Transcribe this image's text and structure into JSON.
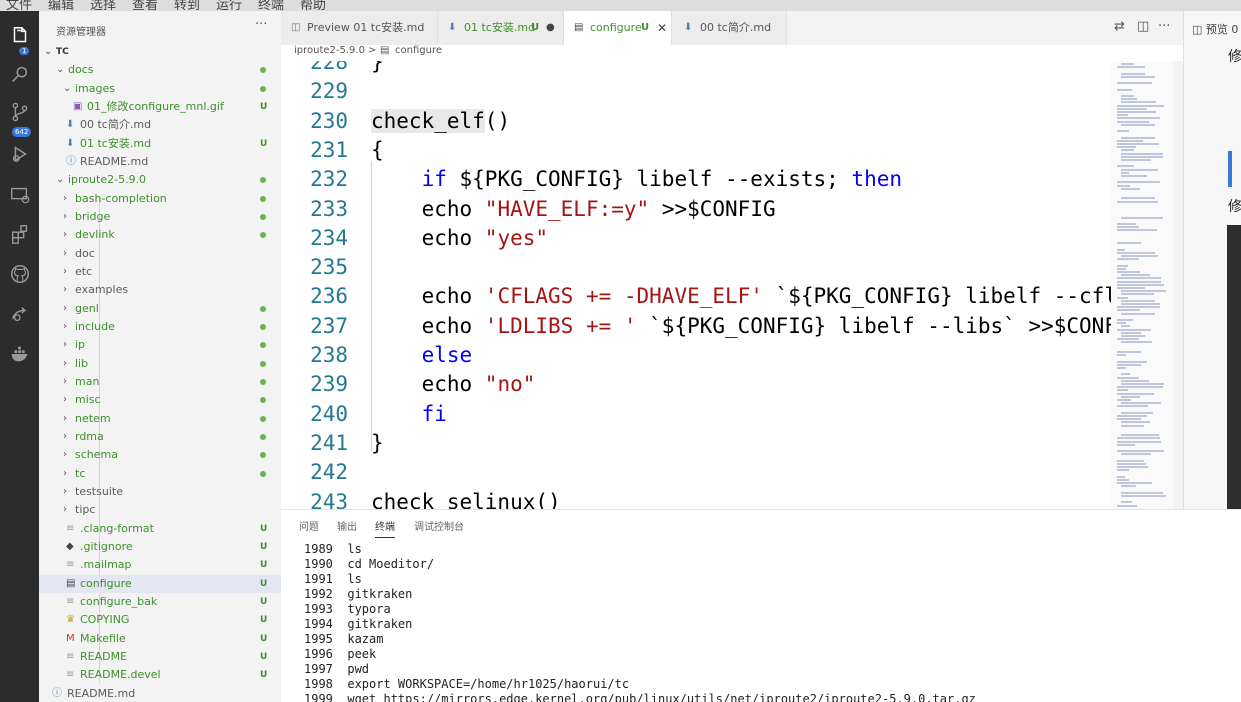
{
  "menu": [
    "文件",
    "编辑",
    "选择",
    "查看",
    "转到",
    "运行",
    "终端",
    "帮助"
  ],
  "activity": {
    "explorer_badge": "1",
    "scm_badge": "642"
  },
  "sidebar": {
    "title": "资源管理器",
    "more": "···",
    "root": "TC",
    "items": [
      {
        "label": "docs",
        "type": "folder-open",
        "status": "dot"
      },
      {
        "label": "images",
        "type": "folder-open",
        "status": "dot"
      },
      {
        "label": "01_修改configure_mnl.gif",
        "type": "image",
        "status": "U"
      },
      {
        "label": "00 tc简介.md",
        "type": "md",
        "status": ""
      },
      {
        "label": "01 tc安装.md",
        "type": "md",
        "status": "U"
      },
      {
        "label": "README.md",
        "type": "info",
        "status": ""
      },
      {
        "label": "iproute2-5.9.0",
        "type": "folder-open",
        "status": "dot"
      },
      {
        "label": "bash-completion",
        "type": "folder",
        "status": "dot"
      },
      {
        "label": "bridge",
        "type": "folder",
        "status": "dot"
      },
      {
        "label": "devlink",
        "type": "folder",
        "status": "dot"
      },
      {
        "label": "doc",
        "type": "folder",
        "status": ""
      },
      {
        "label": "etc",
        "type": "folder",
        "status": ""
      },
      {
        "label": "examples",
        "type": "folder",
        "status": ""
      },
      {
        "label": "genl",
        "type": "folder",
        "status": "dot"
      },
      {
        "label": "include",
        "type": "folder",
        "status": "dot"
      },
      {
        "label": "ip",
        "type": "folder",
        "status": "dot"
      },
      {
        "label": "lib",
        "type": "folder",
        "status": "dot"
      },
      {
        "label": "man",
        "type": "folder",
        "status": "dot"
      },
      {
        "label": "misc",
        "type": "folder",
        "status": "dot"
      },
      {
        "label": "netem",
        "type": "folder",
        "status": "dot"
      },
      {
        "label": "rdma",
        "type": "folder",
        "status": "dot"
      },
      {
        "label": "schema",
        "type": "folder",
        "status": "dot"
      },
      {
        "label": "tc",
        "type": "folder",
        "status": "dot"
      },
      {
        "label": "testsuite",
        "type": "folder",
        "status": ""
      },
      {
        "label": "tipc",
        "type": "folder",
        "status": ""
      },
      {
        "label": ".clang-format",
        "type": "file",
        "status": "U"
      },
      {
        "label": ".gitignore",
        "type": "git",
        "status": "U"
      },
      {
        "label": ".mailmap",
        "type": "file",
        "status": "U"
      },
      {
        "label": "configure",
        "type": "doc",
        "status": "U"
      },
      {
        "label": "configure_bak",
        "type": "file",
        "status": "U"
      },
      {
        "label": "COPYING",
        "type": "license",
        "status": "U"
      },
      {
        "label": "Makefile",
        "type": "make",
        "status": "U"
      },
      {
        "label": "README",
        "type": "file",
        "status": "U"
      },
      {
        "label": "README.devel",
        "type": "file",
        "status": "U"
      },
      {
        "label": "README.md",
        "type": "info",
        "status": ""
      }
    ]
  },
  "tabs": [
    {
      "label": "Preview 01 tc安装.md",
      "status": ""
    },
    {
      "label": "01 tc安装.md",
      "status": "U"
    },
    {
      "label": "configure",
      "status": "U"
    },
    {
      "label": "00 tc简介.md",
      "status": ""
    }
  ],
  "breadcrumb": {
    "folder": "iproute2-5.9.0",
    "sep": ">",
    "file": "configure"
  },
  "editor": {
    "lines": [
      {
        "n": "228",
        "parts": [
          [
            "p",
            "}"
          ]
        ]
      },
      {
        "n": "229",
        "parts": []
      },
      {
        "n": "230",
        "parts": [
          [
            "fn",
            "check_elf"
          ],
          [
            "p",
            "()"
          ]
        ]
      },
      {
        "n": "231",
        "parts": [
          [
            "p",
            "{"
          ]
        ]
      },
      {
        "n": "232",
        "parts": [
          [
            "p",
            "    "
          ],
          [
            "kw",
            "if"
          ],
          [
            "p",
            " ${PKG_CONFIG} libelf --exists; "
          ],
          [
            "kw",
            "then"
          ]
        ]
      },
      {
        "n": "233",
        "parts": [
          [
            "p",
            "    echo "
          ],
          [
            "str",
            "\"HAVE_ELF:=y\""
          ],
          [
            "p",
            " >>$CONFIG"
          ]
        ]
      },
      {
        "n": "234",
        "parts": [
          [
            "p",
            "    echo "
          ],
          [
            "str",
            "\"yes\""
          ]
        ]
      },
      {
        "n": "235",
        "parts": []
      },
      {
        "n": "236",
        "parts": [
          [
            "p",
            "    echo "
          ],
          [
            "str",
            "'CFLAGS += -DHAVE_ELF'"
          ],
          [
            "p",
            " `${PKG_CONFIG} libelf --cflags`"
          ]
        ]
      },
      {
        "n": "237",
        "parts": [
          [
            "p",
            "    echo "
          ],
          [
            "str",
            "'LDLIBS += '"
          ],
          [
            "p",
            " `${PKG_CONFIG} libelf --libs` >>$CONFIG"
          ]
        ]
      },
      {
        "n": "238",
        "parts": [
          [
            "p",
            "    "
          ],
          [
            "kw",
            "else"
          ]
        ]
      },
      {
        "n": "239",
        "parts": [
          [
            "p",
            "    echo "
          ],
          [
            "str",
            "\"no\""
          ]
        ]
      },
      {
        "n": "240",
        "parts": [
          [
            "p",
            "    "
          ],
          [
            "kw",
            "fi"
          ]
        ]
      },
      {
        "n": "241",
        "parts": [
          [
            "p",
            "}"
          ]
        ]
      },
      {
        "n": "242",
        "parts": []
      },
      {
        "n": "243",
        "parts": [
          [
            "p",
            "check_selinux()"
          ]
        ]
      }
    ]
  },
  "preview": {
    "tab": "预览 0",
    "heading1": "修",
    "heading2": "修"
  },
  "panel": {
    "tabs": [
      "问题",
      "输出",
      "终端",
      "调试控制台"
    ],
    "active_tab": "终端",
    "terminal": [
      "1989  ls",
      "1990  cd Moeditor/",
      "1991  ls",
      "1992  gitkraken",
      "1993  typora",
      "1994  gitkraken",
      "1995  kazam",
      "1996  peek",
      "1997  pwd",
      "1998  export WORKSPACE=/home/hr1025/haorui/tc",
      "1999  wget https://mirrors.edge.kernel.org/pub/linux/utils/net/iproute2/iproute2-5.9.0.tar.gz"
    ]
  }
}
